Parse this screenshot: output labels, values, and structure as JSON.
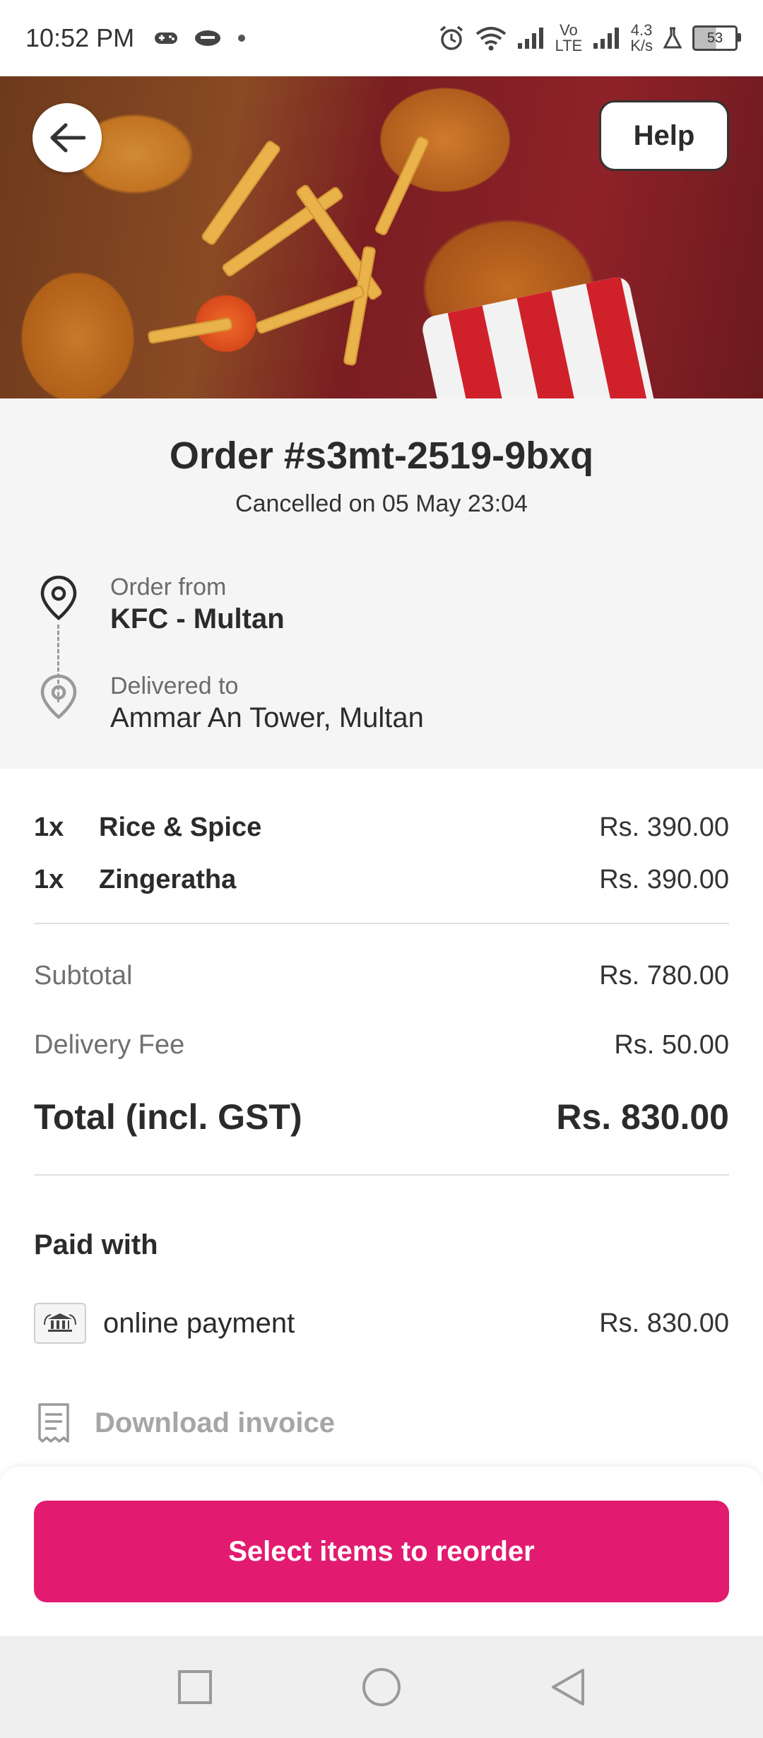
{
  "status_bar": {
    "time": "10:52 PM",
    "network_speed_value": "4.3",
    "network_speed_unit": "K/s",
    "volte_top": "Vo",
    "volte_bottom": "LTE",
    "battery": "53"
  },
  "header": {
    "help_label": "Help"
  },
  "order": {
    "title": "Order #s3mt-2519-9bxq",
    "status": "Cancelled on 05 May 23:04",
    "from_label": "Order from",
    "from_value": "KFC - Multan",
    "to_label": "Delivered to",
    "to_value": "Ammar An Tower, Multan"
  },
  "items": [
    {
      "qty": "1x",
      "name": "Rice & Spice",
      "price": "Rs. 390.00"
    },
    {
      "qty": "1x",
      "name": "Zingeratha",
      "price": "Rs. 390.00"
    }
  ],
  "summary": {
    "subtotal_label": "Subtotal",
    "subtotal_value": "Rs. 780.00",
    "delivery_label": "Delivery Fee",
    "delivery_value": "Rs. 50.00",
    "total_label": "Total (incl. GST)",
    "total_value": "Rs. 830.00"
  },
  "payment": {
    "title": "Paid with",
    "method": "online payment",
    "amount": "Rs. 830.00",
    "invoice_label": "Download invoice"
  },
  "cta": {
    "reorder_label": "Select items to reorder"
  },
  "colors": {
    "brand": "#e21b70",
    "text": "#2b2b2b",
    "muted": "#707070"
  }
}
